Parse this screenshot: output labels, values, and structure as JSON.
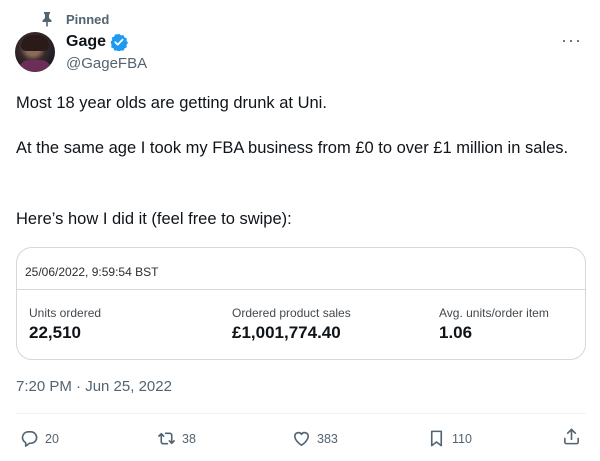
{
  "pinned_label": "Pinned",
  "author": {
    "name": "Gage",
    "handle": "@GageFBA",
    "verified": true
  },
  "tweet": {
    "line1": "Most 18 year olds are getting drunk at Uni.",
    "line2": "At the same age I took my FBA business from £0 to over £1 million in sales.",
    "line3": "Here’s how I did it (feel free to swipe):"
  },
  "card": {
    "date": "25/06/2022, 9:59:54 BST",
    "metrics": [
      {
        "label": "Units ordered",
        "value": "22,510"
      },
      {
        "label": "Ordered product sales",
        "value": "£1,001,774.40"
      },
      {
        "label": "Avg. units/order item",
        "value": "1.06"
      }
    ]
  },
  "timestamp": "7:20 PM · Jun 25, 2022",
  "actions": {
    "replies": "20",
    "retweets": "38",
    "likes": "383",
    "bookmarks": "110"
  },
  "more_label": "···",
  "colors": {
    "verified": "#1d9bf0",
    "secondary_text": "#536471",
    "border": "#cfd9de"
  },
  "icons": [
    "pin-icon",
    "verified-badge-icon",
    "more-icon",
    "reply-icon",
    "retweet-icon",
    "like-icon",
    "bookmark-icon",
    "share-icon"
  ]
}
